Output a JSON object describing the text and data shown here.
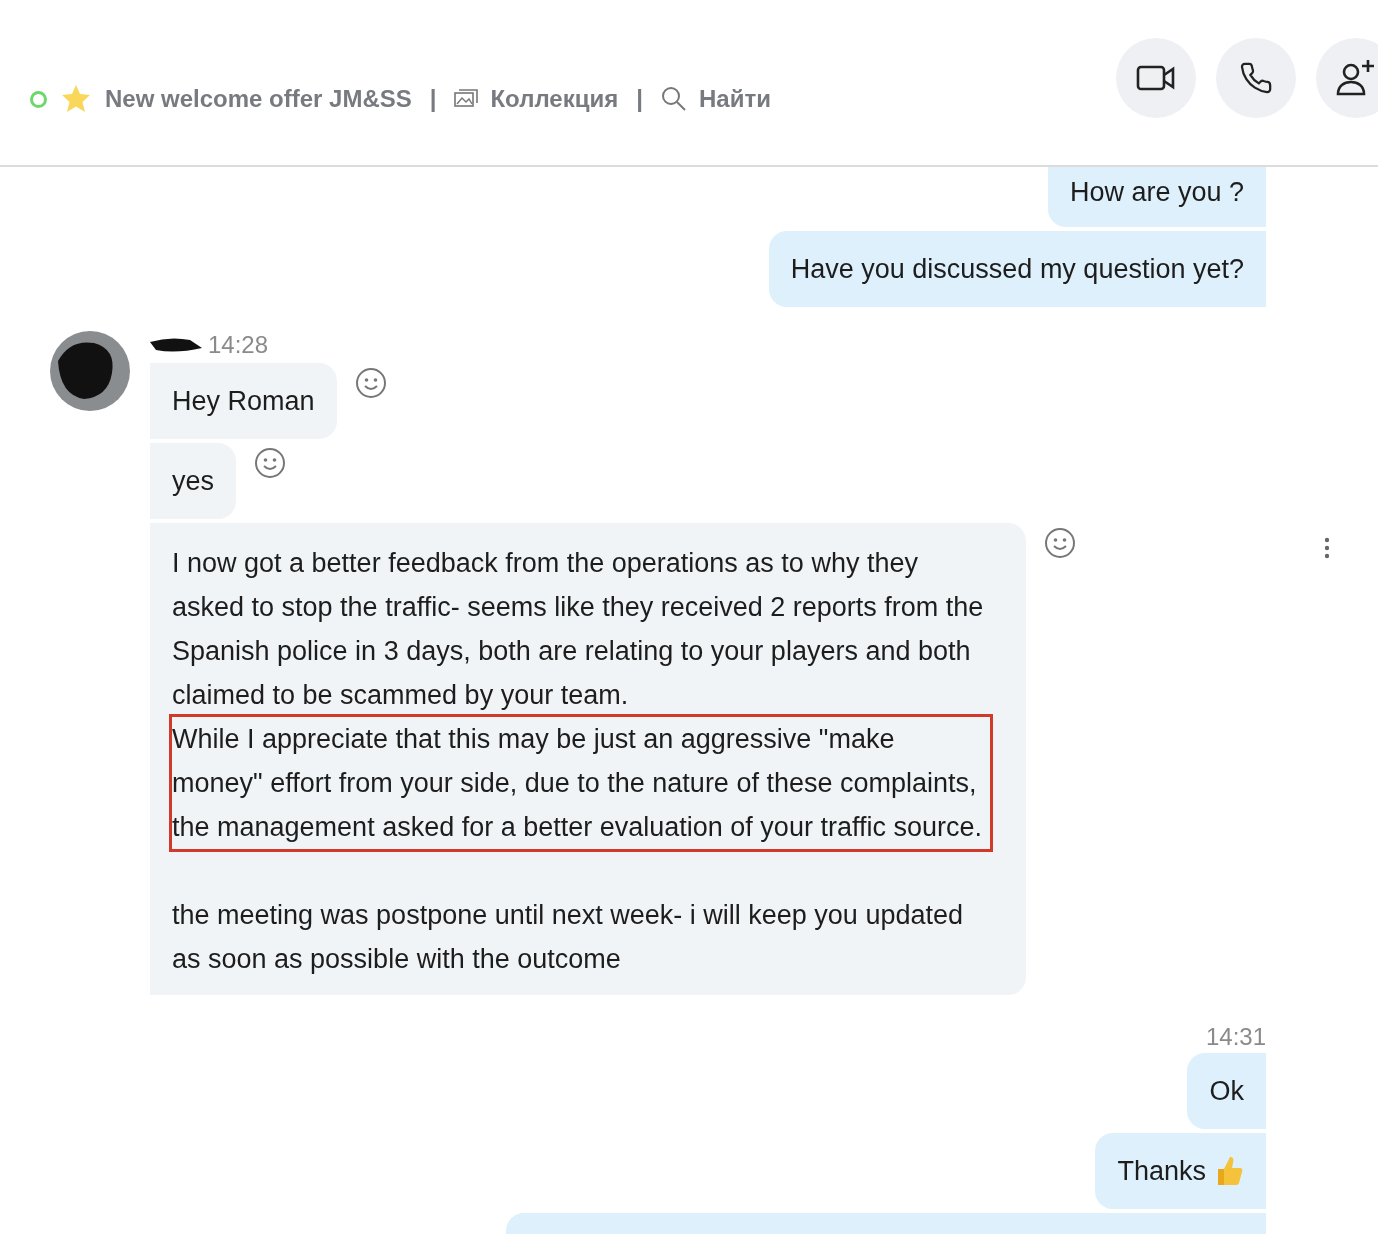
{
  "header": {
    "status_online": true,
    "title": "New welcome offer JM&SS",
    "separator": "|",
    "collection_label": "Коллекция",
    "search_label": "Найти"
  },
  "messages": [
    {
      "kind": "outgoing",
      "text": "How are you ?",
      "cut_top": true
    },
    {
      "kind": "outgoing",
      "text": "Have you discussed my question yet?"
    },
    {
      "kind": "incoming",
      "time": "14:28",
      "text": "Hey Roman",
      "first": true
    },
    {
      "kind": "incoming",
      "text": "yes"
    },
    {
      "kind": "incoming",
      "paragraphs": [
        {
          "text": "I now got a better feedback from the operations as to why they asked to stop the traffic- seems like they received 2 reports from the Spanish police in 3 days, both are relating to your players and both claimed to be scammed by your team.",
          "highlighted": false
        },
        {
          "text": "While I appreciate that this may be just an aggressive \"make money\" effort from your side, due to the nature of these complaints, the management asked for a better evaluation of your traffic source.",
          "highlighted": true
        },
        {
          "text": "the meeting was postpone until next week- i will keep you updated as soon as possible with the outcome",
          "highlighted": false,
          "gap_before": true
        }
      ],
      "menu": true
    },
    {
      "kind": "outgoing",
      "time": "14:31",
      "text": "Ok"
    },
    {
      "kind": "outgoing",
      "text": "Thanks",
      "thumbs_up": true
    },
    {
      "kind": "outgoing",
      "cut_bottom": true
    }
  ]
}
